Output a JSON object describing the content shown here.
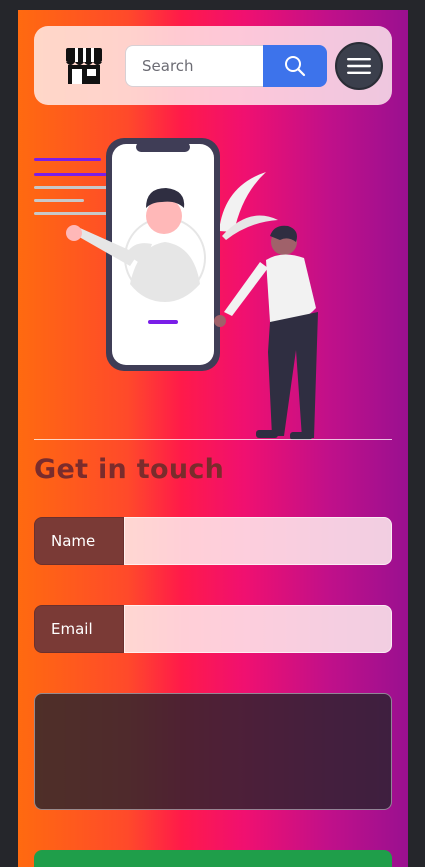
{
  "header": {
    "search": {
      "placeholder": "Search",
      "value": ""
    }
  },
  "icons": {
    "logo": "store-icon",
    "search": "search-icon",
    "menu": "hamburger-menu-icon"
  },
  "contact": {
    "title": "Get in touch",
    "name_label": "Name",
    "email_label": "Email"
  },
  "colors": {
    "search_button": "#3d73eb",
    "menu_button": "#3b3f4c",
    "title": "#7a2c2c",
    "field_label": "#7a3a36",
    "submit_button": "#1f9e4a"
  }
}
